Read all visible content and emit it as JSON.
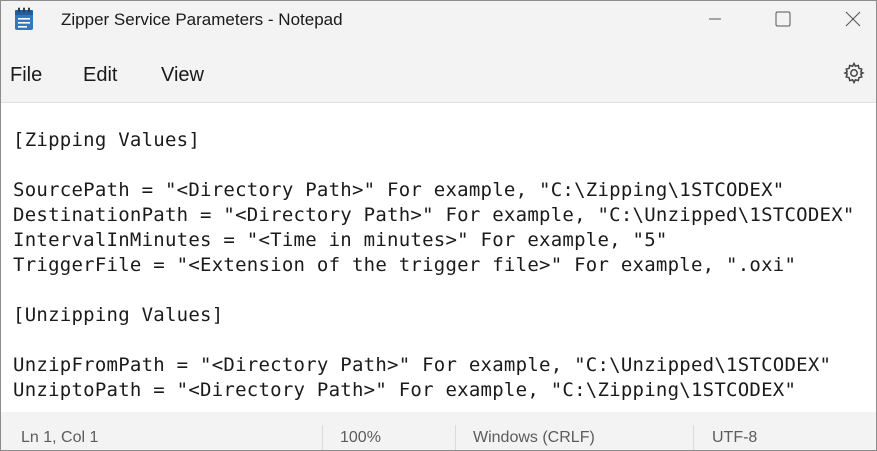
{
  "window": {
    "title": "Zipper Service Parameters - Notepad"
  },
  "menu": {
    "file": "File",
    "edit": "Edit",
    "view": "View"
  },
  "editor": {
    "lines": [
      "[Zipping Values]",
      "",
      "SourcePath = \"<Directory Path>\" For example, \"C:\\Zipping\\1STCODEX\"",
      "DestinationPath = \"<Directory Path>\" For example, \"C:\\Unzipped\\1STCODEX\"",
      "IntervalInMinutes = \"<Time in minutes>\" For example, \"5\"",
      "TriggerFile = \"<Extension of the trigger file>\" For example, \".oxi\"",
      "",
      "[Unzipping Values]",
      "",
      "UnzipFromPath = \"<Directory Path>\" For example, \"C:\\Unzipped\\1STCODEX\"",
      "UnziptoPath = \"<Directory Path>\" For example, \"C:\\Zipping\\1STCODEX\""
    ]
  },
  "status": {
    "position": "Ln 1, Col 1",
    "zoom": "100%",
    "line_ending": "Windows (CRLF)",
    "encoding": "UTF-8"
  },
  "icons": {
    "app": "notepad-icon",
    "minimize": "minimize-icon",
    "maximize": "maximize-icon",
    "close": "close-icon",
    "settings": "gear-icon"
  },
  "colors": {
    "app_icon": "#2f78c4",
    "chrome_bg": "#f3f3f3",
    "editor_bg": "#ffffff"
  }
}
